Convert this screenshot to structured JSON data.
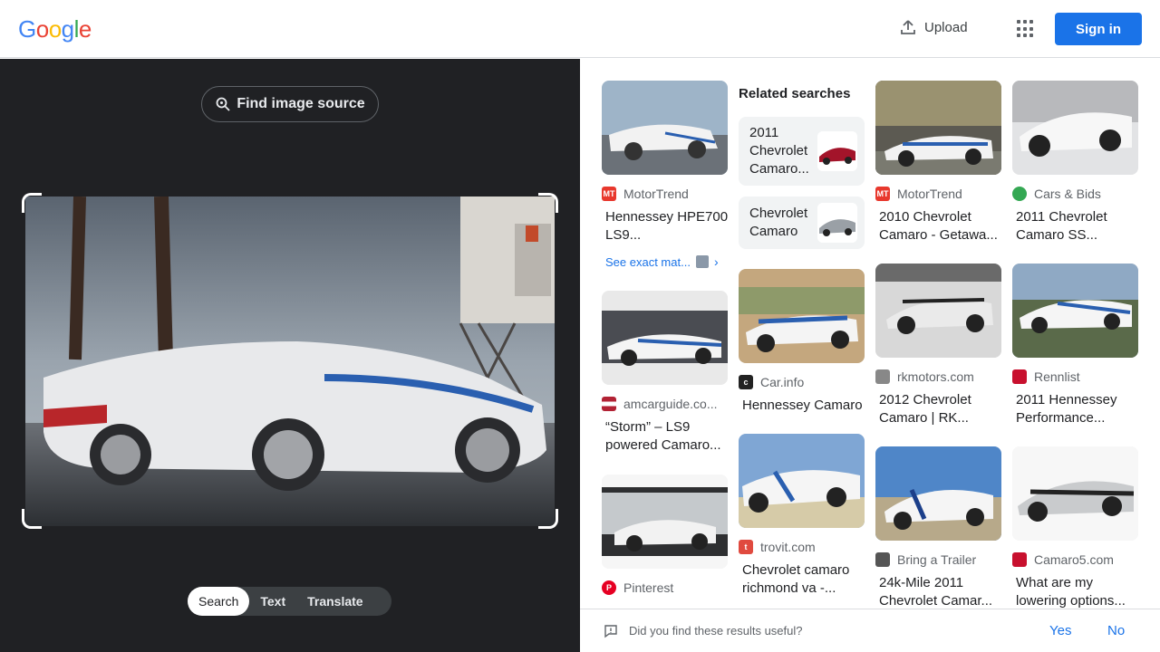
{
  "header": {
    "logo_letters": [
      "G",
      "o",
      "o",
      "g",
      "l",
      "e"
    ],
    "logo_colors": [
      "#4285F4",
      "#EA4335",
      "#FBBC05",
      "#4285F4",
      "#34A853",
      "#EA4335"
    ],
    "upload_label": "Upload",
    "signin_label": "Sign in"
  },
  "lens": {
    "find_source_label": "Find image source",
    "modes": [
      "Search",
      "Text",
      "Translate"
    ],
    "active_mode": "Search"
  },
  "related": {
    "title": "Related searches",
    "items": [
      {
        "label": "2011 Chevrolet Camaro..."
      },
      {
        "label": "Chevrolet Camaro"
      }
    ]
  },
  "see_exact": "See exact mat...",
  "results": [
    {
      "source": "MotorTrend",
      "title": "Hennessey HPE700 LS9...",
      "favicon": "MT",
      "favicon_color": "#e8382d"
    },
    {
      "source": "amcarguide.co...",
      "title": "“Storm” – LS9 powered Camaro...",
      "favicon": "",
      "favicon_color": "#b22234"
    },
    {
      "source": "Pinterest",
      "title": "",
      "favicon": "P",
      "favicon_color": "#e60023"
    },
    {
      "source": "Car.info",
      "title": "Hennessey Camaro",
      "favicon": "c",
      "favicon_color": "#222"
    },
    {
      "source": "trovit.com",
      "title": "Chevrolet camaro richmond va -...",
      "favicon": "t",
      "favicon_color": "#e04a3f"
    },
    {
      "source": "MotorTrend",
      "title": "2010 Chevrolet Camaro - Getawa...",
      "favicon": "MT",
      "favicon_color": "#e8382d"
    },
    {
      "source": "rkmotors.com",
      "title": "2012 Chevrolet Camaro | RK...",
      "favicon": "",
      "favicon_color": "#888"
    },
    {
      "source": "Bring a Trailer",
      "title": "24k-Mile 2011 Chevrolet Camar...",
      "favicon": "",
      "favicon_color": "#555"
    },
    {
      "source": "Cars & Bids",
      "title": "2011 Chevrolet Camaro SS...",
      "favicon": "",
      "favicon_color": "#34a853"
    },
    {
      "source": "Rennlist",
      "title": "2011 Hennessey Performance...",
      "favicon": "",
      "favicon_color": "#c8102e"
    },
    {
      "source": "Camaro5.com",
      "title": "What are my lowering options...",
      "favicon": "",
      "favicon_color": "#c8102e"
    }
  ],
  "feedback": {
    "question": "Did you find these results useful?",
    "yes": "Yes",
    "no": "No"
  }
}
